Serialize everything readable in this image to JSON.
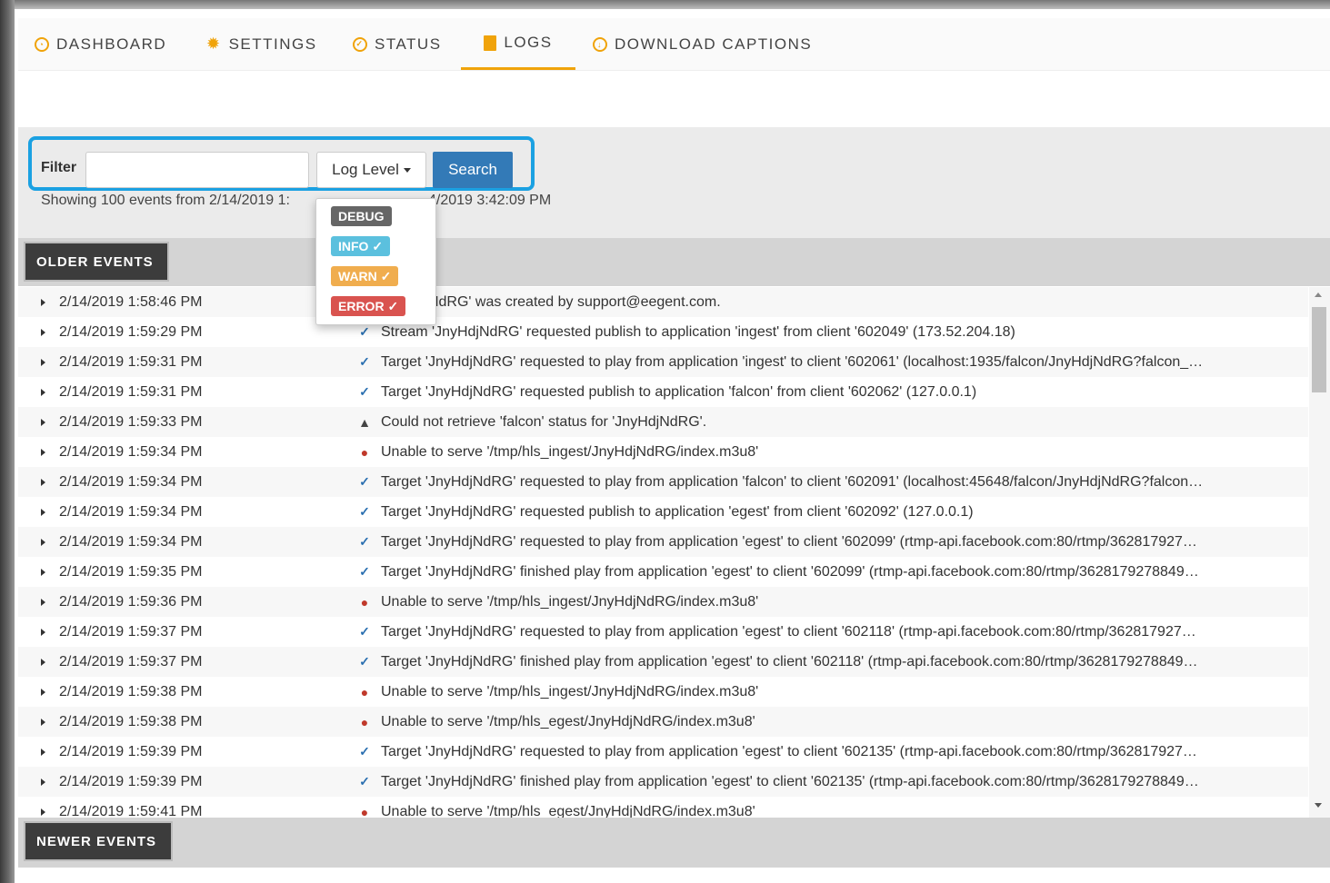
{
  "nav": {
    "tabs": [
      {
        "label": "DASHBOARD",
        "icon": "dashboard-icon"
      },
      {
        "label": "SETTINGS",
        "icon": "gear-icon"
      },
      {
        "label": "STATUS",
        "icon": "check-circle-icon"
      },
      {
        "label": "LOGS",
        "icon": "document-icon",
        "active": true
      },
      {
        "label": "DOWNLOAD CAPTIONS",
        "icon": "download-icon"
      }
    ],
    "accent": "#f0a30a"
  },
  "filter": {
    "label": "Filter",
    "value": "",
    "placeholder": "",
    "log_level_label": "Log Level",
    "search_label": "Search",
    "showing_start": "Showing 100 events from 2/14/2019 1:",
    "showing_end": "4/2019 3:42:09 PM"
  },
  "log_levels": [
    {
      "label": "DEBUG",
      "checked": false,
      "color": "#666666"
    },
    {
      "label": "INFO",
      "checked": true,
      "color": "#5bc0de"
    },
    {
      "label": "WARN",
      "checked": true,
      "color": "#f0ad4e"
    },
    {
      "label": "ERROR",
      "checked": true,
      "color": "#d9534f"
    }
  ],
  "buttons": {
    "older": "OLDER EVENTS",
    "newer": "NEWER EVENTS"
  },
  "events": [
    {
      "ts": "2/14/2019 1:58:46 PM",
      "sev": "ok",
      "msg": "'JnyHdjNdRG' was created by support@eegent.com."
    },
    {
      "ts": "2/14/2019 1:59:29 PM",
      "sev": "ok",
      "msg": "Stream 'JnyHdjNdRG' requested publish to application 'ingest' from client '602049' (173.52.204.18)"
    },
    {
      "ts": "2/14/2019 1:59:31 PM",
      "sev": "ok",
      "msg": "Target 'JnyHdjNdRG' requested to play from application 'ingest' to client '602061' (localhost:1935/falcon/JnyHdjNdRG?falcon_…"
    },
    {
      "ts": "2/14/2019 1:59:31 PM",
      "sev": "ok",
      "msg": "Target 'JnyHdjNdRG' requested publish to application 'falcon' from client '602062' (127.0.0.1)"
    },
    {
      "ts": "2/14/2019 1:59:33 PM",
      "sev": "warn",
      "msg": "Could not retrieve 'falcon' status for 'JnyHdjNdRG'."
    },
    {
      "ts": "2/14/2019 1:59:34 PM",
      "sev": "err",
      "msg": "Unable to serve '/tmp/hls_ingest/JnyHdjNdRG/index.m3u8'"
    },
    {
      "ts": "2/14/2019 1:59:34 PM",
      "sev": "ok",
      "msg": "Target 'JnyHdjNdRG' requested to play from application 'falcon' to client '602091' (localhost:45648/falcon/JnyHdjNdRG?falcon…"
    },
    {
      "ts": "2/14/2019 1:59:34 PM",
      "sev": "ok",
      "msg": "Target 'JnyHdjNdRG' requested publish to application 'egest' from client '602092' (127.0.0.1)"
    },
    {
      "ts": "2/14/2019 1:59:34 PM",
      "sev": "ok",
      "msg": "Target 'JnyHdjNdRG' requested to play from application 'egest' to client '602099' (rtmp-api.facebook.com:80/rtmp/362817927…"
    },
    {
      "ts": "2/14/2019 1:59:35 PM",
      "sev": "ok",
      "msg": "Target 'JnyHdjNdRG' finished play from application 'egest' to client '602099' (rtmp-api.facebook.com:80/rtmp/3628179278849…"
    },
    {
      "ts": "2/14/2019 1:59:36 PM",
      "sev": "err",
      "msg": "Unable to serve '/tmp/hls_ingest/JnyHdjNdRG/index.m3u8'"
    },
    {
      "ts": "2/14/2019 1:59:37 PM",
      "sev": "ok",
      "msg": "Target 'JnyHdjNdRG' requested to play from application 'egest' to client '602118' (rtmp-api.facebook.com:80/rtmp/362817927…"
    },
    {
      "ts": "2/14/2019 1:59:37 PM",
      "sev": "ok",
      "msg": "Target 'JnyHdjNdRG' finished play from application 'egest' to client '602118' (rtmp-api.facebook.com:80/rtmp/3628179278849…"
    },
    {
      "ts": "2/14/2019 1:59:38 PM",
      "sev": "err",
      "msg": "Unable to serve '/tmp/hls_ingest/JnyHdjNdRG/index.m3u8'"
    },
    {
      "ts": "2/14/2019 1:59:38 PM",
      "sev": "err",
      "msg": "Unable to serve '/tmp/hls_egest/JnyHdjNdRG/index.m3u8'"
    },
    {
      "ts": "2/14/2019 1:59:39 PM",
      "sev": "ok",
      "msg": "Target 'JnyHdjNdRG' requested to play from application 'egest' to client '602135' (rtmp-api.facebook.com:80/rtmp/362817927…"
    },
    {
      "ts": "2/14/2019 1:59:39 PM",
      "sev": "ok",
      "msg": "Target 'JnyHdjNdRG' finished play from application 'egest' to client '602135' (rtmp-api.facebook.com:80/rtmp/3628179278849…"
    },
    {
      "ts": "2/14/2019 1:59:41 PM",
      "sev": "err",
      "msg": "Unable to serve '/tmp/hls_egest/JnyHdjNdRG/index.m3u8'"
    }
  ]
}
